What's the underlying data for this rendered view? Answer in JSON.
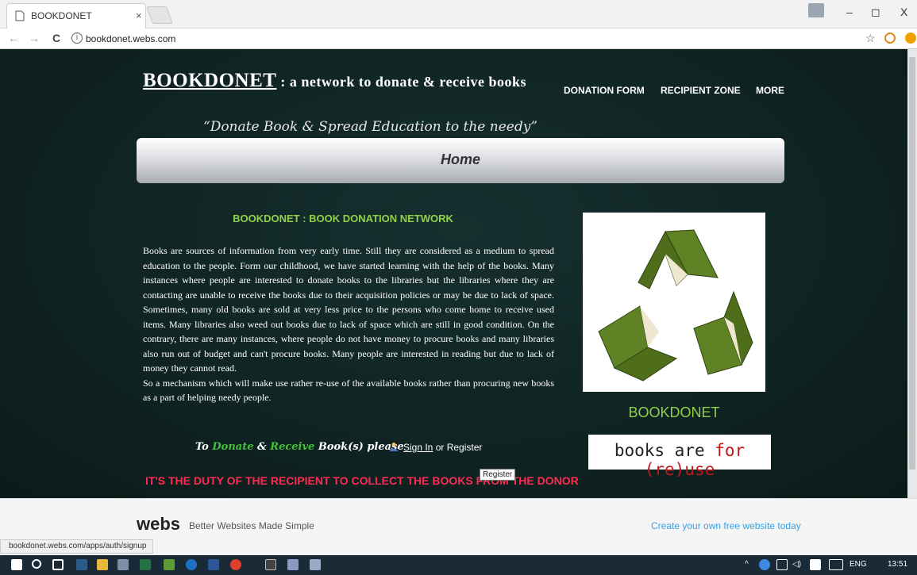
{
  "browser": {
    "tab_title": "BOOKDONET",
    "tab_close": "×",
    "address": "bookdonet.webs.com",
    "info_icon": "i",
    "nav": {
      "back": "←",
      "forward": "→",
      "reload": "C"
    },
    "window": {
      "minimize": "–",
      "restore": "◻",
      "close": "X"
    },
    "toolbar_icons": [
      "star-icon",
      "extension-icon",
      "alert-icon"
    ]
  },
  "site": {
    "brand": "BOOKDONET",
    "title_rest": " : a network to donate & receive books",
    "motto": "“Donate Book & Spread Education to the needy”",
    "nav": {
      "donation": "DONATION FORM",
      "recipient": "RECIPIENT ZONE",
      "more": "MORE"
    },
    "home_label": "Home",
    "section_title": "BOOKDONET : BOOK DONATION NETWORK",
    "paragraph1": "Books are sources of information from very early time. Still they are considered as a medium to spread education to the people. Form our childhood, we have started learning with the help of the books. Many instances where people are interested to donate books to the libraries but the libraries where they are contacting are unable to receive the books due to their acquisition policies or may be due to lack of space. Sometimes, many old books are sold at very less price to the persons who come home to receive used items. Many libraries also weed out books due to lack of space which are still in good condition. On the contrary, there are many instances, where people do not have money to procure books and many libraries also run out of budget and can't procure books. Many people are interested in reading but due to lack of money they cannot read.",
    "paragraph2": "So a mechanism which will make use rather re-use of the available books rather than procuring new books as a part of helping needy people.",
    "cta": {
      "to": "To ",
      "donate": "Donate",
      "amp": " & ",
      "receive": "Receive",
      "rest": " Book(s) please"
    },
    "signin": {
      "link": "Sign In",
      "or": " or ",
      "register": "Register"
    },
    "tooltip": "Register",
    "duty": "IT'S THE DUTY OF THE RECIPIENT TO COLLECT THE BOOKS FROM THE DONOR",
    "sidebar_brand": "BOOKDONET",
    "reuse": {
      "a": "books are ",
      "b": "for (re)use"
    }
  },
  "footer": {
    "logo": "webs",
    "tagline": "Better Websites Made Simple",
    "create": "Create your own free website today",
    "status_url": "bookdonet.webs.com/apps/auth/signup"
  },
  "taskbar": {
    "lang": "ENG",
    "time": "13:51"
  },
  "colors": {
    "accent_green": "#8fd24a",
    "duty_red": "#ff2a52",
    "bg_dark": "#0f2423"
  }
}
